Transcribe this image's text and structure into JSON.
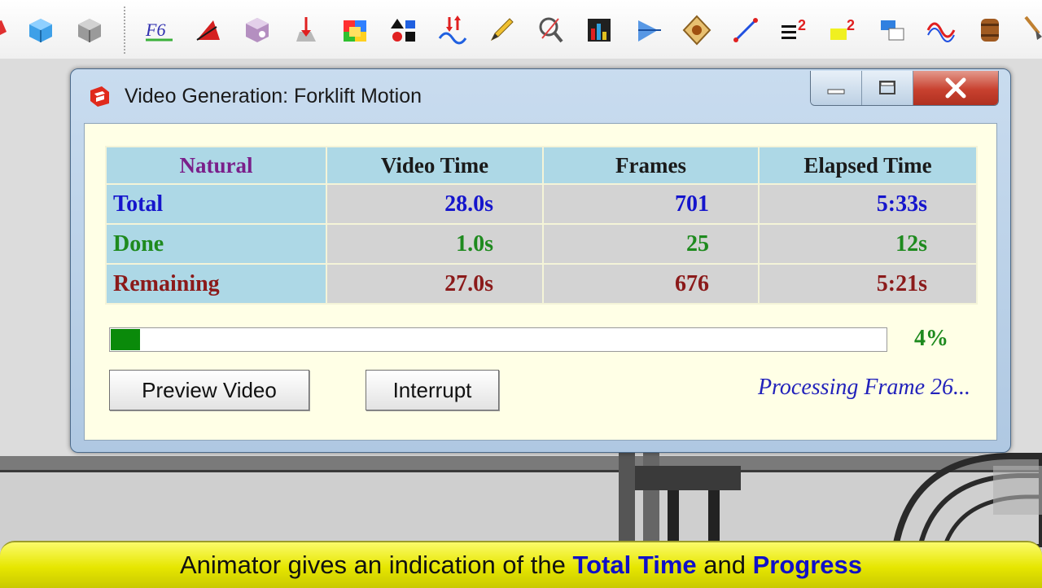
{
  "toolbar": {
    "icons": [
      "red-shape-icon",
      "blue-cube-icon",
      "gray-cube-icon",
      "f6-function-icon",
      "angle-icon",
      "purple-box-icon",
      "red-arrow-icon",
      "color-blocks-icon",
      "shapes-icon",
      "up-down-arrows-icon",
      "pencil-icon",
      "magnify-measure-icon",
      "chart-box-icon",
      "vector-arrow-icon",
      "shield-gear-icon",
      "line-tool-icon",
      "list-squared-icon",
      "yellow-squared-icon",
      "windows-icon",
      "wave-icon",
      "barrel-icon",
      "brush-icon"
    ]
  },
  "window": {
    "title": "Video Generation: Forklift Motion"
  },
  "table": {
    "corner": "Natural",
    "columns": [
      "Video Time",
      "Frames",
      "Elapsed Time"
    ],
    "rows": [
      {
        "label": "Total",
        "video_time": "28.0s",
        "frames": "701",
        "elapsed": "5:33s"
      },
      {
        "label": "Done",
        "video_time": "1.0s",
        "frames": "25",
        "elapsed": "12s"
      },
      {
        "label": "Remaining",
        "video_time": "27.0s",
        "frames": "676",
        "elapsed": "5:21s"
      }
    ]
  },
  "progress": {
    "value_percent": 4,
    "label": "4%",
    "fill_color": "#0a8a0a"
  },
  "buttons": {
    "preview": "Preview Video",
    "interrupt": "Interrupt"
  },
  "status": "Processing Frame 26...",
  "colors": {
    "total": "#1515cc",
    "done": "#1e8a1e",
    "remaining": "#8b1a1a",
    "header_bg": "#add8e6",
    "caption_bg": "#e6e600"
  },
  "caption": {
    "prefix": "Animator gives an indication of the ",
    "highlight1": "Total Time",
    "middle": " and ",
    "highlight2": "Progress"
  }
}
